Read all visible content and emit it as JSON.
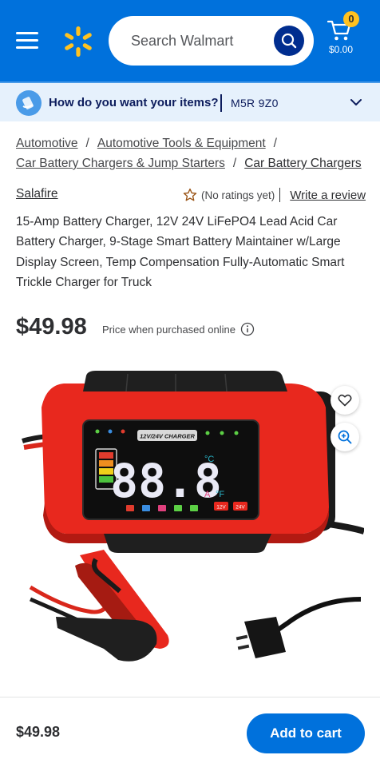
{
  "header": {
    "search_placeholder": "Search Walmart",
    "cart_count": "0",
    "cart_total": "$0.00"
  },
  "delivery": {
    "prompt": "How do you want your items?",
    "zip": "M5R 9Z0"
  },
  "breadcrumb": [
    "Automotive",
    "Automotive Tools & Equipment",
    "Car Battery Chargers & Jump Starters",
    "Car Battery Chargers"
  ],
  "product": {
    "brand": "Salafire",
    "rating_text": "(No ratings yet)",
    "write_review": "Write a review",
    "title": "15-Amp Battery Charger, 12V 24V LiFePO4 Lead Acid Car Battery Charger, 9-Stage Smart Battery Maintainer w/Large Display Screen, Temp Compensation Fully-Automatic Smart Trickle Charger for Truck",
    "price": "$49.98",
    "price_note": "Price when purchased online",
    "display_banner": "12V/24V CHARGER",
    "display_digits": "88.8",
    "tag_12v": "12V",
    "tag_24v": "24V"
  },
  "bottom_bar": {
    "price": "$49.98",
    "add_to_cart": "Add to cart"
  },
  "colors": {
    "brand_blue": "#0071dc",
    "spark_yellow": "#ffc220",
    "dark_blue": "#002d8f",
    "charger_red": "#e8281e"
  }
}
